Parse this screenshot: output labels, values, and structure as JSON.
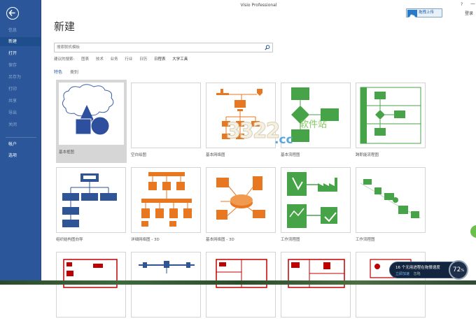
{
  "window": {
    "title": "Visio Professional",
    "help": "?",
    "minimize": "—",
    "close": "✕",
    "signin": "登录",
    "upload_button": "拖拽上传"
  },
  "sidebar": {
    "items": [
      {
        "label": "信息",
        "state": "disabled"
      },
      {
        "label": "新建",
        "state": "active"
      },
      {
        "label": "打开",
        "state": "normal"
      },
      {
        "label": "保存",
        "state": "disabled"
      },
      {
        "label": "另存为",
        "state": "disabled"
      },
      {
        "label": "打印",
        "state": "disabled"
      },
      {
        "label": "共享",
        "state": "disabled"
      },
      {
        "label": "导出",
        "state": "disabled"
      },
      {
        "label": "关闭",
        "state": "disabled"
      },
      {
        "label": "帐户",
        "state": "normal"
      },
      {
        "label": "选项",
        "state": "normal"
      }
    ]
  },
  "main": {
    "title": "新建",
    "search": {
      "placeholder": "搜索联机模板"
    },
    "suggested": {
      "label": "建议的搜索:",
      "items": [
        "图表",
        "技术",
        "业务",
        "行业",
        "日历",
        "日程表",
        "大学工具"
      ]
    },
    "tabs": {
      "featured": "特色",
      "categories": "类别"
    },
    "templates": [
      {
        "label": "基本框图",
        "icon": "basic-diagram-thumbnail",
        "selected": true
      },
      {
        "label": "空白绘图",
        "icon": "blank-drawing-thumbnail"
      },
      {
        "label": "基本网络图",
        "icon": "basic-network-thumbnail"
      },
      {
        "label": "基本流程图",
        "icon": "basic-flowchart-thumbnail"
      },
      {
        "label": "跨职能流程图",
        "icon": "cross-functional-flowchart-thumbnail"
      },
      {
        "label": "组织结构图向导",
        "icon": "org-chart-wizard-thumbnail"
      },
      {
        "label": "详细网络图 - 3D",
        "icon": "detailed-network-3d-thumbnail"
      },
      {
        "label": "基本网络图 - 3D",
        "icon": "basic-network-3d-thumbnail"
      },
      {
        "label": "工作流程图",
        "icon": "workflow-diagram-thumbnail"
      },
      {
        "label": "工作流程图",
        "icon": "workflow-3d-thumbnail"
      },
      {
        "label": "",
        "icon": "floor-plan-thumbnail"
      },
      {
        "label": "",
        "icon": "timeline-thumbnail"
      },
      {
        "label": "",
        "icon": "office-layout-thumbnail"
      },
      {
        "label": "",
        "icon": "home-plan-thumbnail"
      },
      {
        "label": "",
        "icon": "site-plan-thumbnail"
      }
    ]
  },
  "watermark": {
    "digits": "3322",
    "suffix": ".cc",
    "site": "软件站"
  },
  "toast": {
    "message": "16 个无用进程在拖慢速度",
    "action1": "立即加速",
    "action2": "忽略"
  },
  "gauge": {
    "value": "72",
    "unit": "%"
  },
  "colors": {
    "accent": "#2b579a",
    "flow_green": "#47a347",
    "network_orange": "#e87722",
    "org_blue": "#2f5597",
    "plan_red": "#c00000"
  }
}
